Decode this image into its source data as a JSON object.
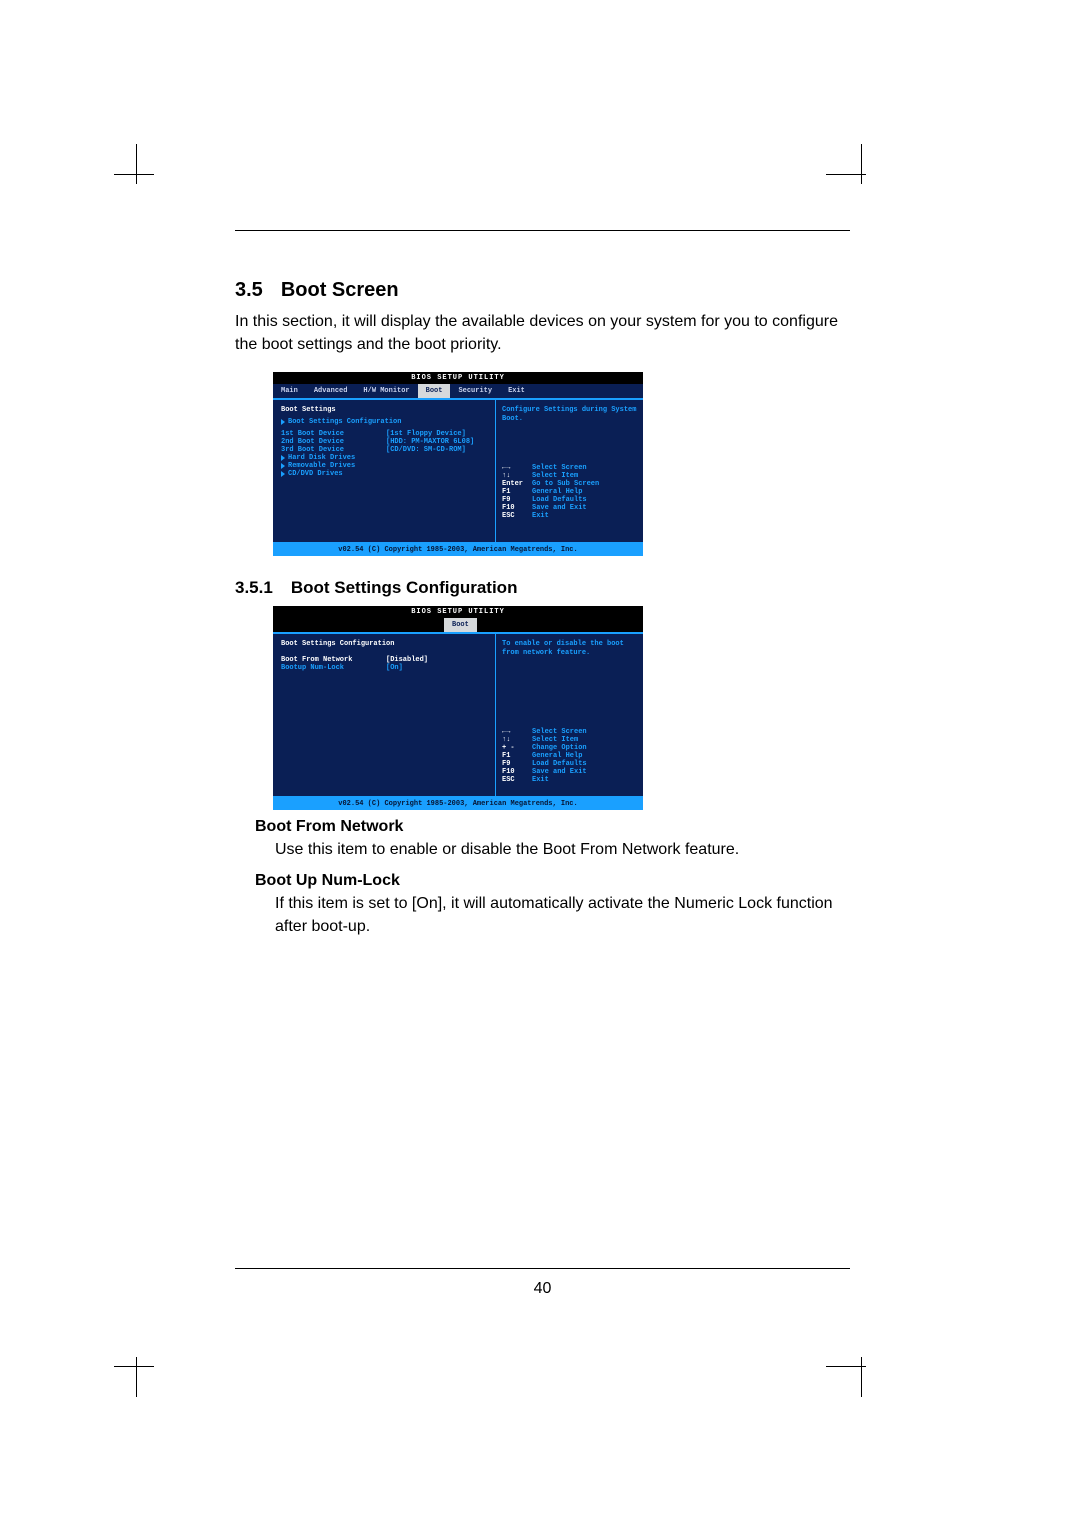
{
  "page_number": "40",
  "sections": {
    "s1_num": "3.5",
    "s1_title": "Boot Screen",
    "s1_body": "In this section, it will display the available devices on your system for you to configure the boot settings and the boot priority.",
    "s2_num": "3.5.1",
    "s2_title": "Boot Settings Configuration"
  },
  "options": {
    "o1_name": "Boot From Network",
    "o1_desc": "Use this item to enable or disable the Boot From Network feature.",
    "o2_name": "Boot Up Num-Lock",
    "o2_desc": "If this item is set to [On], it will automatically activate the Numeric Lock function after boot-up."
  },
  "bios1": {
    "title": "BIOS SETUP UTILITY",
    "tabs": [
      "Main",
      "Advanced",
      "H/W Monitor",
      "Boot",
      "Security",
      "Exit"
    ],
    "active_tab_index": 3,
    "panel_header": "Boot Settings",
    "submenu0": "Boot Settings Configuration",
    "rows": [
      {
        "k": "1st Boot Device",
        "v": "[1st Floppy Device]"
      },
      {
        "k": "2nd Boot Device",
        "v": "[HDD: PM-MAXTOR 6L08]"
      },
      {
        "k": "3rd Boot Device",
        "v": "[CD/DVD: SM-CD-ROM]"
      }
    ],
    "submenus": [
      "Hard Disk Drives",
      "Removable Drives",
      "CD/DVD Drives"
    ],
    "tip": "Configure Settings during System Boot.",
    "help": [
      {
        "k": "←→",
        "d": "Select Screen"
      },
      {
        "k": "↑↓",
        "d": "Select Item"
      },
      {
        "k": "Enter",
        "d": "Go to Sub Screen"
      },
      {
        "k": "F1",
        "d": "General Help"
      },
      {
        "k": "F9",
        "d": "Load Defaults"
      },
      {
        "k": "F10",
        "d": "Save and Exit"
      },
      {
        "k": "ESC",
        "d": "Exit"
      }
    ],
    "copyright": "v02.54 (C) Copyright 1985-2003, American Megatrends, Inc."
  },
  "bios2": {
    "title": "BIOS SETUP UTILITY",
    "active_tab": "Boot",
    "panel_header": "Boot Settings Configuration",
    "rows": [
      {
        "k": "Boot From Network",
        "v": "[Disabled]",
        "sel": true
      },
      {
        "k": "Bootup Num-Lock",
        "v": "[On]",
        "sel": false
      }
    ],
    "tip": "To enable or disable the boot from network feature.",
    "help": [
      {
        "k": "←→",
        "d": "Select Screen"
      },
      {
        "k": "↑↓",
        "d": "Select Item"
      },
      {
        "k": "+ -",
        "d": "Change Option"
      },
      {
        "k": "F1",
        "d": "General Help"
      },
      {
        "k": "F9",
        "d": "Load Defaults"
      },
      {
        "k": "F10",
        "d": "Save and Exit"
      },
      {
        "k": "ESC",
        "d": "Exit"
      }
    ],
    "copyright": "v02.54 (C) Copyright 1985-2003, American Megatrends, Inc."
  }
}
